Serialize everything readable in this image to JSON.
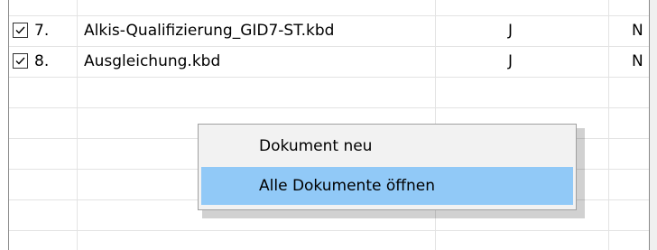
{
  "rows": [
    {
      "checked": true,
      "number": "7.",
      "name": "Alkis-Qualifizierung_GID7-ST.kbd",
      "col3": "J",
      "col4": "N"
    },
    {
      "checked": true,
      "number": "8.",
      "name": "Ausgleichung.kbd",
      "col3": "J",
      "col4": "N"
    }
  ],
  "context_menu": {
    "items": [
      {
        "label": "Dokument neu",
        "highlighted": false
      },
      {
        "label": "Alle Dokumente öffnen",
        "highlighted": true
      }
    ]
  },
  "colors": {
    "highlight": "#91c9f7",
    "menu_background": "#f2f2f2",
    "grid_line": "#e3e3e3"
  },
  "icons": {
    "checkbox": "checkbox-checked-icon"
  }
}
